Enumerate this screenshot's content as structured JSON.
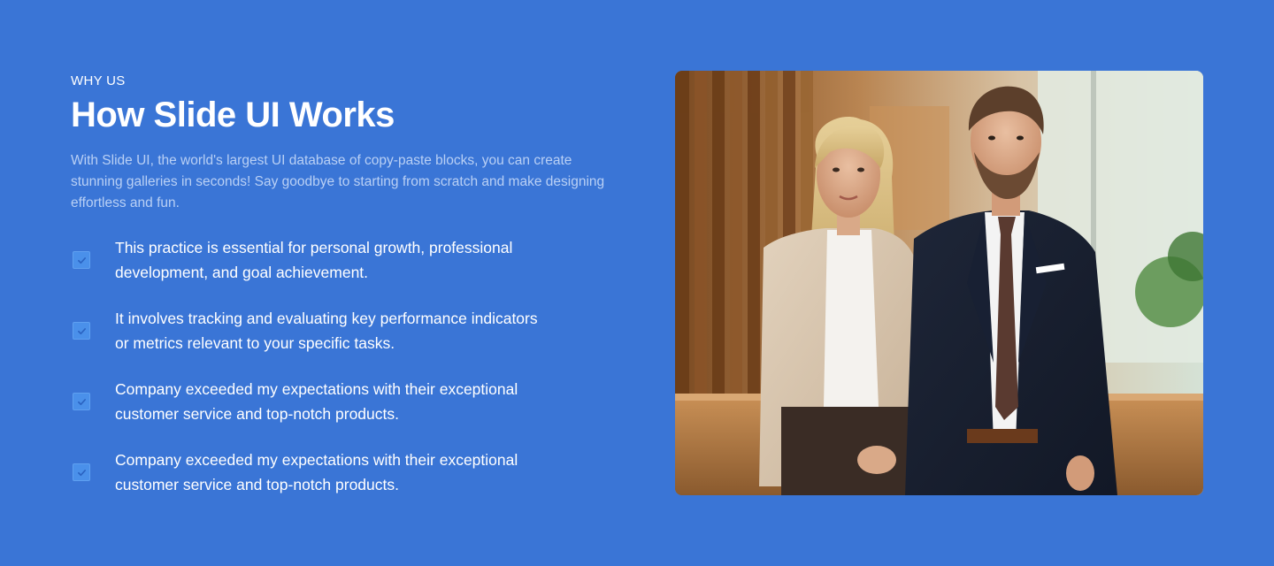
{
  "hero": {
    "eyebrow": "WHY US",
    "title": "How Slide UI Works",
    "description": "With Slide UI, the world's largest UI database of copy-paste blocks, you can create stunning galleries in seconds! Say goodbye to starting from scratch and make designing effortless and fun."
  },
  "features": [
    {
      "text": "This practice is essential for personal growth, professional development, and goal achievement."
    },
    {
      "text": "It involves tracking and evaluating key performance indicators or metrics relevant to your specific tasks."
    },
    {
      "text": "Company exceeded my expectations with their exceptional customer service and top-notch products."
    },
    {
      "text": "Company exceeded my expectations with their exceptional customer service and top-notch products."
    }
  ],
  "image": {
    "subject": "two business people in an office"
  },
  "colors": {
    "background": "#3a75d6",
    "description_text": "#b9d0f5",
    "check_fill": "#4a90ea"
  },
  "icons": {
    "feature_icon": "checkbox-check-icon"
  }
}
